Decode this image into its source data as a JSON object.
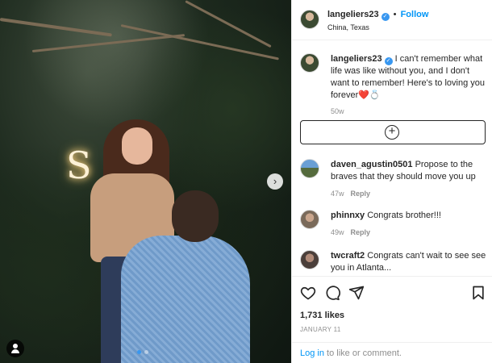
{
  "post": {
    "author": {
      "username": "langeliers23",
      "location": "China, Texas",
      "follow_label": "Follow",
      "separator": "•"
    },
    "caption": {
      "username": "langeliers23",
      "text": "I can't remember what life was like without you, and I don't want to remember! Here's to loving you forever❤️💍",
      "time_ago": "50w"
    },
    "photo": {
      "neon_sign_text": "S",
      "carousel_slides": 2,
      "active_slide": 1
    },
    "comments": [
      {
        "username": "daven_agustin0501",
        "text": "Propose to the braves that they should move you up",
        "time_ago": "47w",
        "reply_label": "Reply"
      },
      {
        "username": "phinnxy",
        "text": "Congrats brother!!!",
        "time_ago": "49w",
        "reply_label": "Reply"
      },
      {
        "username": "twcraft2",
        "text": "Congrats can't wait to see see you in Atlanta...",
        "time_ago": "",
        "reply_label": ""
      }
    ],
    "likes": "1,731 likes",
    "date": "JANUARY 11",
    "login_prompt": {
      "link": "Log in",
      "rest": " to like or comment."
    }
  },
  "icons": {
    "like": "heart-icon",
    "comment": "comment-bubble-icon",
    "share": "paper-plane-icon",
    "save": "bookmark-icon",
    "next": "chevron-right-icon",
    "add_comment": "plus-circle-icon",
    "user_tag": "user-tag-icon",
    "verified": "verified-badge-icon"
  },
  "colors": {
    "link_blue": "#0095f6",
    "verified_blue": "#3897f0",
    "muted": "#8e8e8e"
  }
}
